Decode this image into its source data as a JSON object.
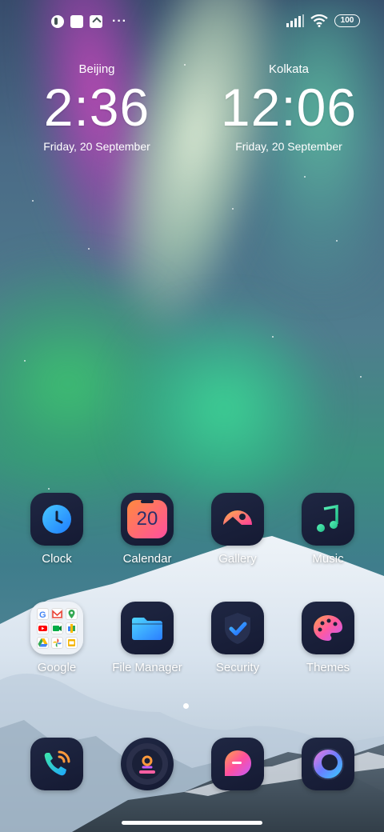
{
  "status_bar": {
    "left_icons": [
      "notification-icon",
      "screenshot-icon",
      "upload-icon"
    ],
    "more_label": "···",
    "battery": "100"
  },
  "clocks": [
    {
      "city": "Beijing",
      "time": "2:36",
      "date": "Friday, 20 September"
    },
    {
      "city": "Kolkata",
      "time": "12:06",
      "date": "Friday, 20 September"
    }
  ],
  "apps": {
    "row1": [
      {
        "label": "Clock",
        "icon": "clock-icon"
      },
      {
        "label": "Calendar",
        "icon": "calendar-icon",
        "day": "20"
      },
      {
        "label": "Gallery",
        "icon": "gallery-icon"
      },
      {
        "label": "Music",
        "icon": "music-icon"
      }
    ],
    "row2": [
      {
        "label": "Google",
        "icon": "google-folder-icon"
      },
      {
        "label": "File Manager",
        "icon": "folder-icon"
      },
      {
        "label": "Security",
        "icon": "shield-icon"
      },
      {
        "label": "Themes",
        "icon": "palette-icon"
      }
    ],
    "dock": [
      {
        "icon": "phone-icon"
      },
      {
        "icon": "contacts-icon"
      },
      {
        "icon": "messages-icon"
      },
      {
        "icon": "browser-icon"
      }
    ]
  },
  "colors": {
    "icon_bg": "#1a2038",
    "accent_blue": "#2f9bff",
    "accent_pink": "#ff5fa2",
    "accent_orange": "#ff9a3c",
    "accent_green": "#3ee0a0"
  }
}
